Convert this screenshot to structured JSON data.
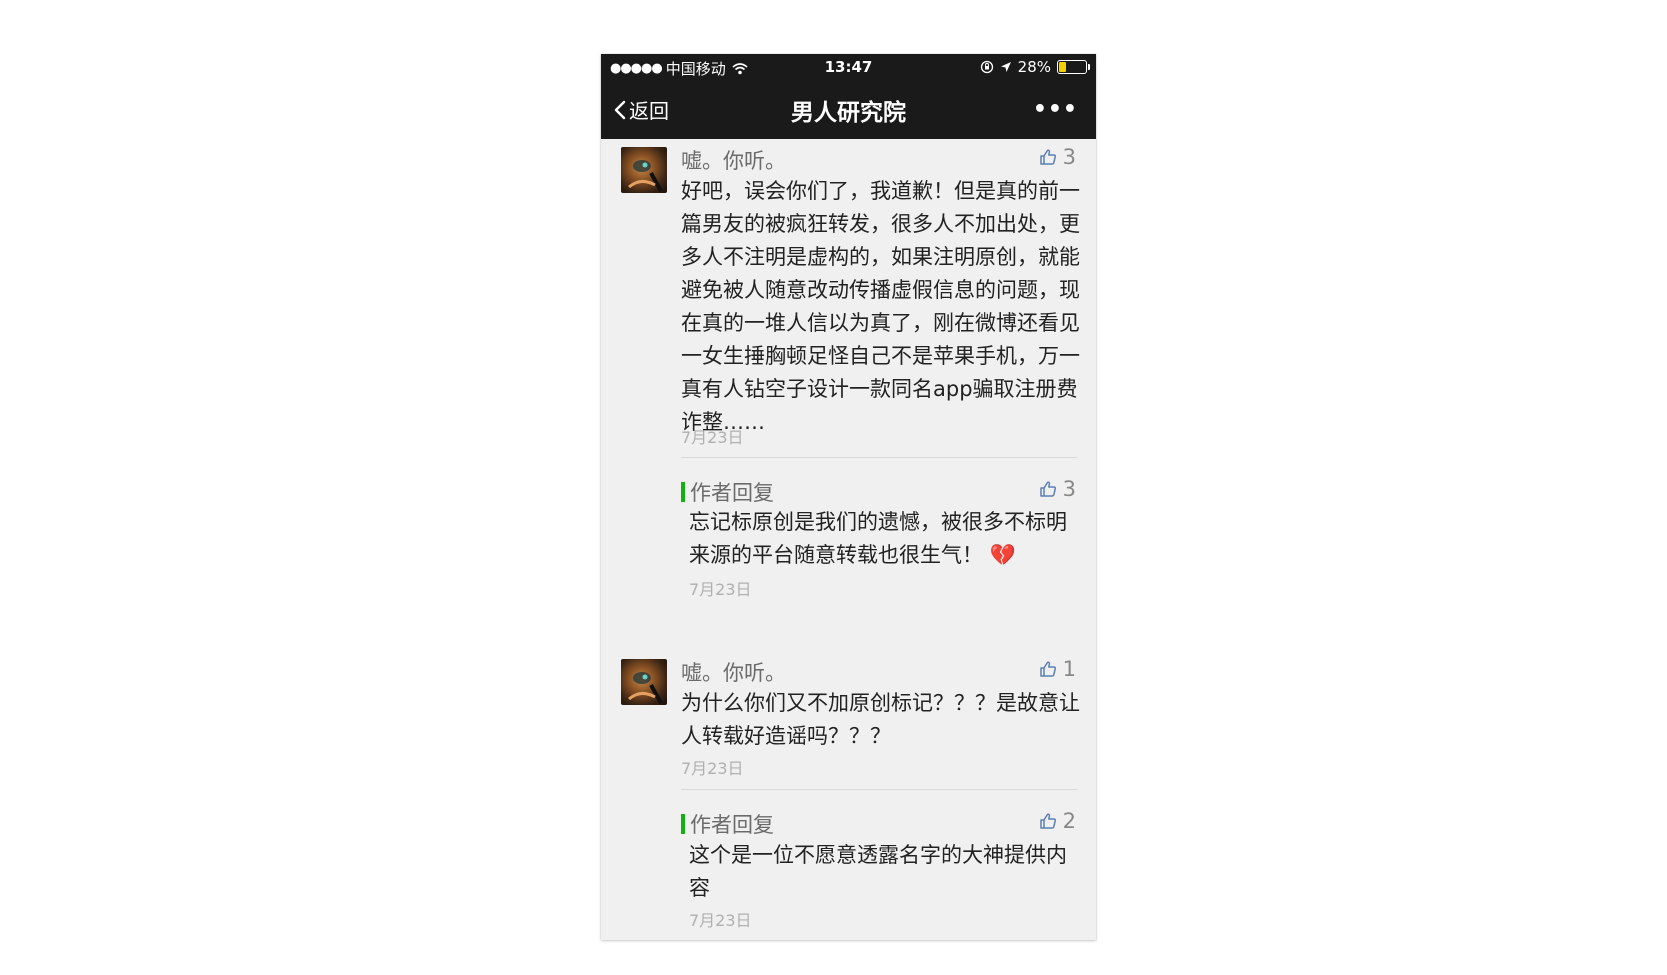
{
  "status": {
    "carrier": "中国移动",
    "time": "13:47",
    "battery_pct": "28%",
    "battery_level": 0.28,
    "signal_dots": "●●●●●"
  },
  "nav": {
    "back_label": "返回",
    "title": "男人研究院",
    "more": "•••"
  },
  "comments": [
    {
      "name": "嘘。你听。",
      "likes": "3",
      "text": "好吧，误会你们了，我道歉！但是真的前一篇男友的被疯狂转发，很多人不加出处，更多人不注明是虚构的，如果注明原创，就能避免被人随意改动传播虚假信息的问题，现在真的一堆人信以为真了，刚在微博还看见一女生捶胸顿足怪自己不是苹果手机，万一真有人钻空子设计一款同名app骗取注册费诈整……",
      "date": "7月23日",
      "reply": {
        "label": "作者回复",
        "likes": "3",
        "text": "忘记标原创是我们的遗憾，被很多不标明来源的平台随意转载也很生气！",
        "emoji": "💔",
        "date": "7月23日"
      }
    },
    {
      "name": "嘘。你听。",
      "likes": "1",
      "text": "为什么你们又不加原创标记？？？是故意让人转载好造谣吗？？？",
      "date": "7月23日",
      "reply": {
        "label": "作者回复",
        "likes": "2",
        "text": "这个是一位不愿意透露名字的大神提供内容",
        "date": "7月23日"
      }
    }
  ],
  "colors": {
    "bar_bg": "#1a1a1a",
    "page_bg": "#f0f0f0",
    "accent_green": "#11b111",
    "like_icon": "#5a7fb5"
  }
}
